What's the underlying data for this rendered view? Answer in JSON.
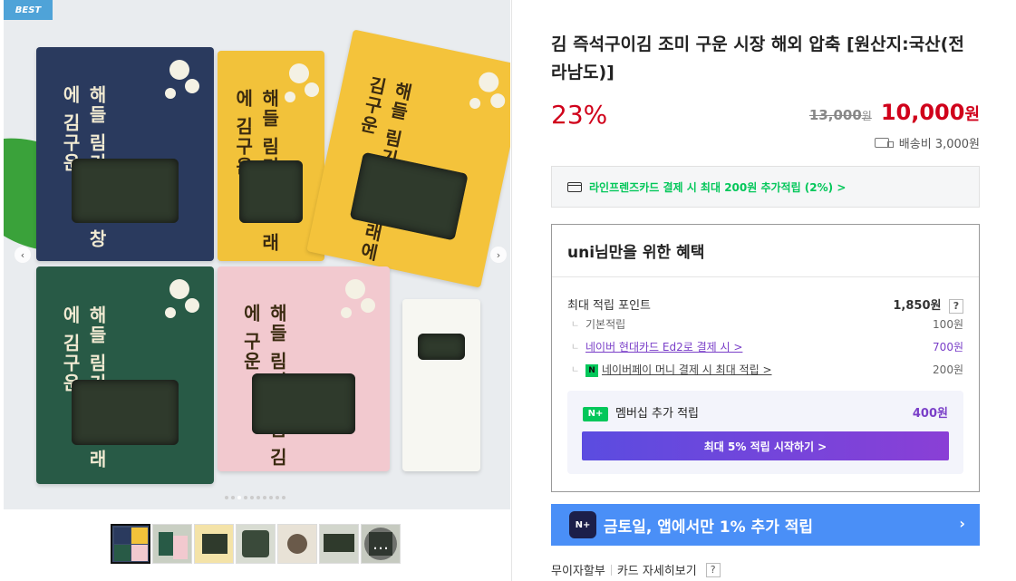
{
  "gallery": {
    "badge": "BEST",
    "nav_prev": "‹",
    "nav_next": "›",
    "dots": 10,
    "active_dot": 2,
    "thumbs": 7,
    "chat_icon": "chat-bubble-icon",
    "packs": [
      {
        "text": "해들\n림기\n곰름\n창에\n김구운",
        "bg": "#2a3a5e",
        "fg": "#f1ead2"
      },
      {
        "text": "해들\n림기\n재름\n래에\n김구운",
        "bg": "#f2c23a",
        "fg": "#3a2a10"
      },
      {
        "text": "해들\n림기\n재름\n래에\n김구운",
        "bg": "#f4c33b",
        "fg": "#3a2a10"
      },
      {
        "text": "해들\n림기\n파름\n래에\n김구운",
        "bg": "#285a46",
        "fg": "#f1ead2"
      },
      {
        "text": "해들\n림기\n돌름\n김에\n구운",
        "bg": "#f2c9cf",
        "fg": "#3a2a10"
      }
    ]
  },
  "product": {
    "title": "김 즉석구이김 조미 구운 시장 해외 압축 [원산지:국산(전라남도)]",
    "discount": "23%",
    "original_price": "13,000",
    "original_unit": "원",
    "sale_price": "10,000",
    "sale_unit": "원",
    "shipping": "배송비 3,000원"
  },
  "card_promo": {
    "text": "라인프렌즈카드 결제 시 최대 200원 추가적립 (2%) >"
  },
  "benefit": {
    "header": "uni님만을 위한 혜택",
    "max_points_label": "최대 적립 포인트",
    "max_points_value": "1,850원",
    "help": "?",
    "base_label": "기본적립",
    "base_value": "100원",
    "naver_card_label": "네이버 현대카드 Ed2로 결제 시 >",
    "naver_card_value": "700원",
    "npay_badge": "N",
    "npay_label": "네이버페이 머니 결제 시 최대 적립 >",
    "npay_value": "200원",
    "membership_badge": "N+",
    "membership_label": "멤버십 추가 적립",
    "membership_value": "400원",
    "membership_button": "최대 5% 적립 시작하기 >"
  },
  "banner": {
    "logo": "N+",
    "text": "금토일, 앱에서만 1% 추가 적립",
    "arrow": "›"
  },
  "footer": {
    "installment": "무이자할부",
    "card_detail": "카드 자세히보기",
    "help": "?"
  },
  "colors": {
    "accent_red": "#d0021b",
    "naver_green": "#03c75a",
    "purple": "#7a3fc8",
    "banner_blue": "#4a8ff7"
  }
}
